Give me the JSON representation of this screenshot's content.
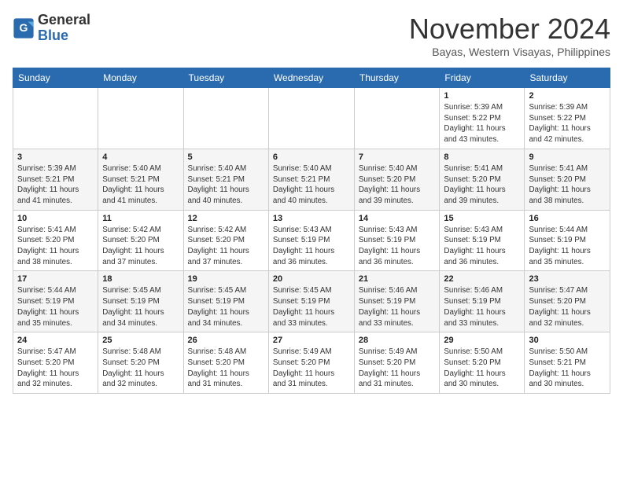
{
  "logo": {
    "general": "General",
    "blue": "Blue"
  },
  "title": "November 2024",
  "location": "Bayas, Western Visayas, Philippines",
  "weekdays": [
    "Sunday",
    "Monday",
    "Tuesday",
    "Wednesday",
    "Thursday",
    "Friday",
    "Saturday"
  ],
  "weeks": [
    [
      {
        "day": "",
        "info": ""
      },
      {
        "day": "",
        "info": ""
      },
      {
        "day": "",
        "info": ""
      },
      {
        "day": "",
        "info": ""
      },
      {
        "day": "",
        "info": ""
      },
      {
        "day": "1",
        "info": "Sunrise: 5:39 AM\nSunset: 5:22 PM\nDaylight: 11 hours\nand 43 minutes."
      },
      {
        "day": "2",
        "info": "Sunrise: 5:39 AM\nSunset: 5:22 PM\nDaylight: 11 hours\nand 42 minutes."
      }
    ],
    [
      {
        "day": "3",
        "info": "Sunrise: 5:39 AM\nSunset: 5:21 PM\nDaylight: 11 hours\nand 41 minutes."
      },
      {
        "day": "4",
        "info": "Sunrise: 5:40 AM\nSunset: 5:21 PM\nDaylight: 11 hours\nand 41 minutes."
      },
      {
        "day": "5",
        "info": "Sunrise: 5:40 AM\nSunset: 5:21 PM\nDaylight: 11 hours\nand 40 minutes."
      },
      {
        "day": "6",
        "info": "Sunrise: 5:40 AM\nSunset: 5:21 PM\nDaylight: 11 hours\nand 40 minutes."
      },
      {
        "day": "7",
        "info": "Sunrise: 5:40 AM\nSunset: 5:20 PM\nDaylight: 11 hours\nand 39 minutes."
      },
      {
        "day": "8",
        "info": "Sunrise: 5:41 AM\nSunset: 5:20 PM\nDaylight: 11 hours\nand 39 minutes."
      },
      {
        "day": "9",
        "info": "Sunrise: 5:41 AM\nSunset: 5:20 PM\nDaylight: 11 hours\nand 38 minutes."
      }
    ],
    [
      {
        "day": "10",
        "info": "Sunrise: 5:41 AM\nSunset: 5:20 PM\nDaylight: 11 hours\nand 38 minutes."
      },
      {
        "day": "11",
        "info": "Sunrise: 5:42 AM\nSunset: 5:20 PM\nDaylight: 11 hours\nand 37 minutes."
      },
      {
        "day": "12",
        "info": "Sunrise: 5:42 AM\nSunset: 5:20 PM\nDaylight: 11 hours\nand 37 minutes."
      },
      {
        "day": "13",
        "info": "Sunrise: 5:43 AM\nSunset: 5:19 PM\nDaylight: 11 hours\nand 36 minutes."
      },
      {
        "day": "14",
        "info": "Sunrise: 5:43 AM\nSunset: 5:19 PM\nDaylight: 11 hours\nand 36 minutes."
      },
      {
        "day": "15",
        "info": "Sunrise: 5:43 AM\nSunset: 5:19 PM\nDaylight: 11 hours\nand 36 minutes."
      },
      {
        "day": "16",
        "info": "Sunrise: 5:44 AM\nSunset: 5:19 PM\nDaylight: 11 hours\nand 35 minutes."
      }
    ],
    [
      {
        "day": "17",
        "info": "Sunrise: 5:44 AM\nSunset: 5:19 PM\nDaylight: 11 hours\nand 35 minutes."
      },
      {
        "day": "18",
        "info": "Sunrise: 5:45 AM\nSunset: 5:19 PM\nDaylight: 11 hours\nand 34 minutes."
      },
      {
        "day": "19",
        "info": "Sunrise: 5:45 AM\nSunset: 5:19 PM\nDaylight: 11 hours\nand 34 minutes."
      },
      {
        "day": "20",
        "info": "Sunrise: 5:45 AM\nSunset: 5:19 PM\nDaylight: 11 hours\nand 33 minutes."
      },
      {
        "day": "21",
        "info": "Sunrise: 5:46 AM\nSunset: 5:19 PM\nDaylight: 11 hours\nand 33 minutes."
      },
      {
        "day": "22",
        "info": "Sunrise: 5:46 AM\nSunset: 5:19 PM\nDaylight: 11 hours\nand 33 minutes."
      },
      {
        "day": "23",
        "info": "Sunrise: 5:47 AM\nSunset: 5:20 PM\nDaylight: 11 hours\nand 32 minutes."
      }
    ],
    [
      {
        "day": "24",
        "info": "Sunrise: 5:47 AM\nSunset: 5:20 PM\nDaylight: 11 hours\nand 32 minutes."
      },
      {
        "day": "25",
        "info": "Sunrise: 5:48 AM\nSunset: 5:20 PM\nDaylight: 11 hours\nand 32 minutes."
      },
      {
        "day": "26",
        "info": "Sunrise: 5:48 AM\nSunset: 5:20 PM\nDaylight: 11 hours\nand 31 minutes."
      },
      {
        "day": "27",
        "info": "Sunrise: 5:49 AM\nSunset: 5:20 PM\nDaylight: 11 hours\nand 31 minutes."
      },
      {
        "day": "28",
        "info": "Sunrise: 5:49 AM\nSunset: 5:20 PM\nDaylight: 11 hours\nand 31 minutes."
      },
      {
        "day": "29",
        "info": "Sunrise: 5:50 AM\nSunset: 5:20 PM\nDaylight: 11 hours\nand 30 minutes."
      },
      {
        "day": "30",
        "info": "Sunrise: 5:50 AM\nSunset: 5:21 PM\nDaylight: 11 hours\nand 30 minutes."
      }
    ]
  ]
}
